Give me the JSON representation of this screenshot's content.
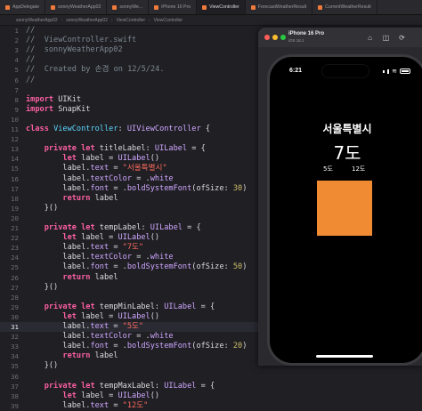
{
  "tabs": [
    {
      "label": "AppDelegate",
      "active": false
    },
    {
      "label": "sonnyWeatherApp02",
      "active": false
    },
    {
      "label": "sonnyWe...",
      "active": false
    },
    {
      "label": "iPhone 16 Pro",
      "active": false
    },
    {
      "label": "ViewController",
      "active": true
    },
    {
      "label": "ForecastWeatherResult",
      "active": false
    },
    {
      "label": "CurrentWeatherResult",
      "active": false
    }
  ],
  "jumpbar": [
    "sonnyWeatherApp02",
    "sonnyWeatherApp02",
    "ViewController",
    "ViewController"
  ],
  "code_lines": [
    [
      [
        "cm",
        "//"
      ]
    ],
    [
      [
        "cm",
        "//  ViewController.swift"
      ]
    ],
    [
      [
        "cm",
        "//  sonnyWeatherApp02"
      ]
    ],
    [
      [
        "cm",
        "//"
      ]
    ],
    [
      [
        "cm",
        "//  Created by 손겸 on 12/5/24."
      ]
    ],
    [
      [
        "cm",
        "//"
      ]
    ],
    [],
    [
      [
        "kw",
        "import"
      ],
      [
        "pl",
        " UIKit"
      ]
    ],
    [
      [
        "kw",
        "import"
      ],
      [
        "pl",
        " SnapKit"
      ]
    ],
    [],
    [
      [
        "kw",
        "class"
      ],
      [
        "pl",
        " "
      ],
      [
        "ty",
        "ViewController"
      ],
      [
        "pl",
        ": "
      ],
      [
        "tyc",
        "UIViewController"
      ],
      [
        "pl",
        " {"
      ]
    ],
    [],
    [
      [
        "pl",
        "    "
      ],
      [
        "kw",
        "private let"
      ],
      [
        "pl",
        " titleLabel: "
      ],
      [
        "tyc",
        "UILabel"
      ],
      [
        "pl",
        " = {"
      ]
    ],
    [
      [
        "pl",
        "        "
      ],
      [
        "kw",
        "let"
      ],
      [
        "pl",
        " label = "
      ],
      [
        "tyc",
        "UILabel"
      ],
      [
        "pl",
        "()"
      ]
    ],
    [
      [
        "pl",
        "        label."
      ],
      [
        "tyc",
        "text"
      ],
      [
        "pl",
        " = "
      ],
      [
        "st",
        "\"서울특별시\""
      ]
    ],
    [
      [
        "pl",
        "        label."
      ],
      [
        "tyc",
        "textColor"
      ],
      [
        "pl",
        " = ."
      ],
      [
        "tyc",
        "white"
      ]
    ],
    [
      [
        "pl",
        "        label."
      ],
      [
        "tyc",
        "font"
      ],
      [
        "pl",
        " = ."
      ],
      [
        "tyc",
        "boldSystemFont"
      ],
      [
        "pl",
        "(ofSize: "
      ],
      [
        "nu",
        "30"
      ],
      [
        "pl",
        ")"
      ]
    ],
    [
      [
        "pl",
        "        "
      ],
      [
        "kw",
        "return"
      ],
      [
        "pl",
        " label"
      ]
    ],
    [
      [
        "pl",
        "    }()"
      ]
    ],
    [],
    [
      [
        "pl",
        "    "
      ],
      [
        "kw",
        "private let"
      ],
      [
        "pl",
        " tempLabel: "
      ],
      [
        "tyc",
        "UILabel"
      ],
      [
        "pl",
        " = {"
      ]
    ],
    [
      [
        "pl",
        "        "
      ],
      [
        "kw",
        "let"
      ],
      [
        "pl",
        " label = "
      ],
      [
        "tyc",
        "UILabel"
      ],
      [
        "pl",
        "()"
      ]
    ],
    [
      [
        "pl",
        "        label."
      ],
      [
        "tyc",
        "text"
      ],
      [
        "pl",
        " = "
      ],
      [
        "st",
        "\"7도\""
      ]
    ],
    [
      [
        "pl",
        "        label."
      ],
      [
        "tyc",
        "textColor"
      ],
      [
        "pl",
        " = ."
      ],
      [
        "tyc",
        "white"
      ]
    ],
    [
      [
        "pl",
        "        label."
      ],
      [
        "tyc",
        "font"
      ],
      [
        "pl",
        " = ."
      ],
      [
        "tyc",
        "boldSystemFont"
      ],
      [
        "pl",
        "(ofSize: "
      ],
      [
        "nu",
        "50"
      ],
      [
        "pl",
        ")"
      ]
    ],
    [
      [
        "pl",
        "        "
      ],
      [
        "kw",
        "return"
      ],
      [
        "pl",
        " label"
      ]
    ],
    [
      [
        "pl",
        "    }()"
      ]
    ],
    [],
    [
      [
        "pl",
        "    "
      ],
      [
        "kw",
        "private let"
      ],
      [
        "pl",
        " tempMinLabel: "
      ],
      [
        "tyc",
        "UILabel"
      ],
      [
        "pl",
        " = {"
      ]
    ],
    [
      [
        "pl",
        "        "
      ],
      [
        "kw",
        "let"
      ],
      [
        "pl",
        " label = "
      ],
      [
        "tyc",
        "UILabel"
      ],
      [
        "pl",
        "()"
      ]
    ],
    [
      [
        "pl",
        "        label."
      ],
      [
        "tyc",
        "text"
      ],
      [
        "pl",
        " = "
      ],
      [
        "st",
        "\"5도\""
      ]
    ],
    [
      [
        "pl",
        "        label."
      ],
      [
        "tyc",
        "textColor"
      ],
      [
        "pl",
        " = ."
      ],
      [
        "tyc",
        "white"
      ]
    ],
    [
      [
        "pl",
        "        label."
      ],
      [
        "tyc",
        "font"
      ],
      [
        "pl",
        " = ."
      ],
      [
        "tyc",
        "boldSystemFont"
      ],
      [
        "pl",
        "(ofSize: "
      ],
      [
        "nu",
        "20"
      ],
      [
        "pl",
        ")"
      ]
    ],
    [
      [
        "pl",
        "        "
      ],
      [
        "kw",
        "return"
      ],
      [
        "pl",
        " label"
      ]
    ],
    [
      [
        "pl",
        "    }()"
      ]
    ],
    [],
    [
      [
        "pl",
        "    "
      ],
      [
        "kw",
        "private let"
      ],
      [
        "pl",
        " tempMaxLabel: "
      ],
      [
        "tyc",
        "UILabel"
      ],
      [
        "pl",
        " = {"
      ]
    ],
    [
      [
        "pl",
        "        "
      ],
      [
        "kw",
        "let"
      ],
      [
        "pl",
        " label = "
      ],
      [
        "tyc",
        "UILabel"
      ],
      [
        "pl",
        "()"
      ]
    ],
    [
      [
        "pl",
        "        label."
      ],
      [
        "tyc",
        "text"
      ],
      [
        "pl",
        " = "
      ],
      [
        "st",
        "\"12도\""
      ]
    ]
  ],
  "current_line": 31,
  "simulator": {
    "device": "iPhone 16 Pro",
    "os": "iOS 18.1",
    "time": "6:21",
    "city": "서울특별시",
    "temp": "7도",
    "temp_min": "5도",
    "temp_max": "12도",
    "box_color": "#f08a33"
  }
}
